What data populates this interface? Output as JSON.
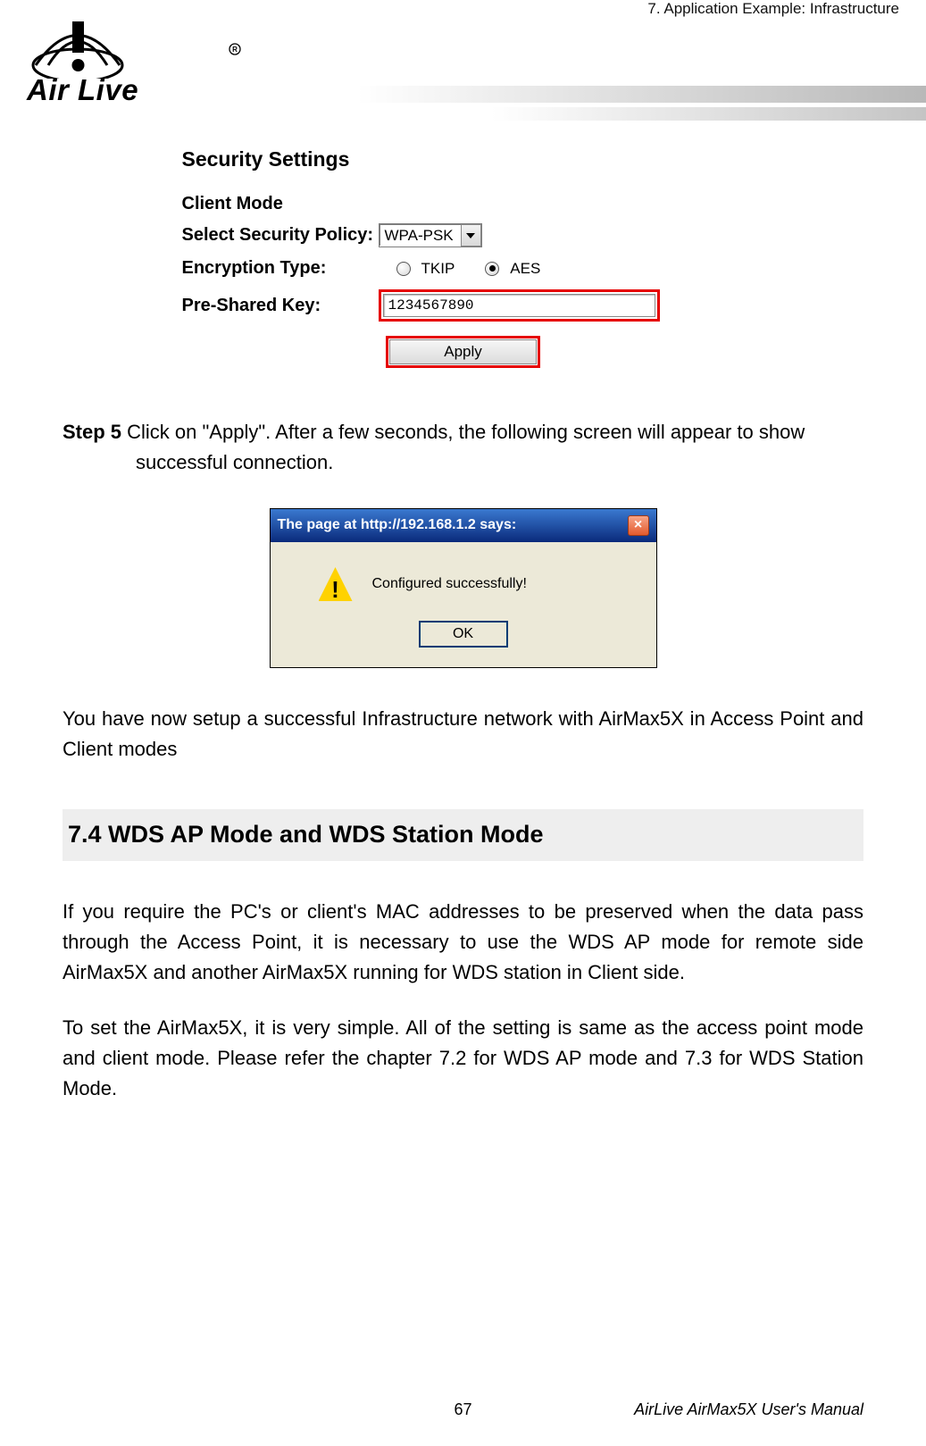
{
  "header_right": "7. Application Example: Infrastructure",
  "logo_text": "Air Live",
  "security": {
    "title": "Security Settings",
    "subtitle": "Client Mode",
    "policy_label": "Select Security Policy:",
    "policy_value": "WPA-PSK",
    "enc_label": "Encryption Type:",
    "enc_tkip": "TKIP",
    "enc_aes": "AES",
    "psk_label": "Pre-Shared Key:",
    "psk_value": "1234567890",
    "apply_label": "Apply"
  },
  "step5_bold": "Step 5",
  "step5_rest": " Click on \"Apply\". After a few seconds, the following screen will appear to show",
  "step5_line2": "successful connection.",
  "dialog": {
    "title": "The page at http://192.168.1.2 says:",
    "msg": "Configured successfully!",
    "ok": "OK"
  },
  "conclusion": "You have now setup a successful Infrastructure network with AirMax5X in Access Point and Client modes",
  "section_heading": "7.4 WDS AP Mode and WDS Station Mode",
  "wds_p1": "If you require the PC's or client's MAC addresses to be preserved when the data pass through the Access Point, it is necessary to use the WDS AP mode for remote side AirMax5X and another AirMax5X running for WDS station in Client side.",
  "wds_p2": "To set the AirMax5X, it is very simple. All of the setting is same as the access point mode and client mode.  Please refer the chapter 7.2 for WDS AP mode and 7.3 for WDS Station Mode.",
  "page_number": "67",
  "footer_right": "AirLive AirMax5X User's Manual"
}
